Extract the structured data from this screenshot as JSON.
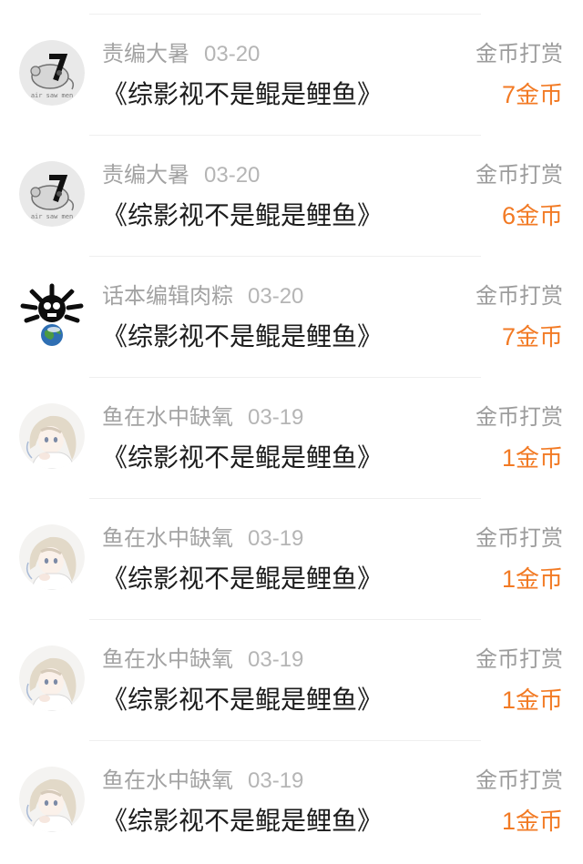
{
  "reward_list": [
    {
      "user": "责编大暑",
      "date": "03-20",
      "book": "《综影视不是鲲是鲤鱼》",
      "action": "金币打赏",
      "amount": "7",
      "unit": "金币",
      "avatar": "rat-robot-avatar"
    },
    {
      "user": "责编大暑",
      "date": "03-20",
      "book": "《综影视不是鲲是鲤鱼》",
      "action": "金币打赏",
      "amount": "6",
      "unit": "金币",
      "avatar": "rat-robot-avatar"
    },
    {
      "user": "话本编辑肉粽",
      "date": "03-20",
      "book": "《综影视不是鲲是鲤鱼》",
      "action": "金币打赏",
      "amount": "7",
      "unit": "金币",
      "avatar": "skull-earth-avatar"
    },
    {
      "user": "鱼在水中缺氧",
      "date": "03-19",
      "book": "《综影视不是鲲是鲤鱼》",
      "action": "金币打赏",
      "amount": "1",
      "unit": "金币",
      "avatar": "anime-girl-avatar"
    },
    {
      "user": "鱼在水中缺氧",
      "date": "03-19",
      "book": "《综影视不是鲲是鲤鱼》",
      "action": "金币打赏",
      "amount": "1",
      "unit": "金币",
      "avatar": "anime-girl-avatar"
    },
    {
      "user": "鱼在水中缺氧",
      "date": "03-19",
      "book": "《综影视不是鲲是鲤鱼》",
      "action": "金币打赏",
      "amount": "1",
      "unit": "金币",
      "avatar": "anime-girl-avatar"
    },
    {
      "user": "鱼在水中缺氧",
      "date": "03-19",
      "book": "《综影视不是鲲是鲤鱼》",
      "action": "金币打赏",
      "amount": "1",
      "unit": "金币",
      "avatar": "anime-girl-avatar"
    }
  ],
  "colors": {
    "amount": "#f27a24",
    "secondary_text": "#9c9c9c",
    "primary_text": "#1c1c1c",
    "divider": "#efefef"
  }
}
